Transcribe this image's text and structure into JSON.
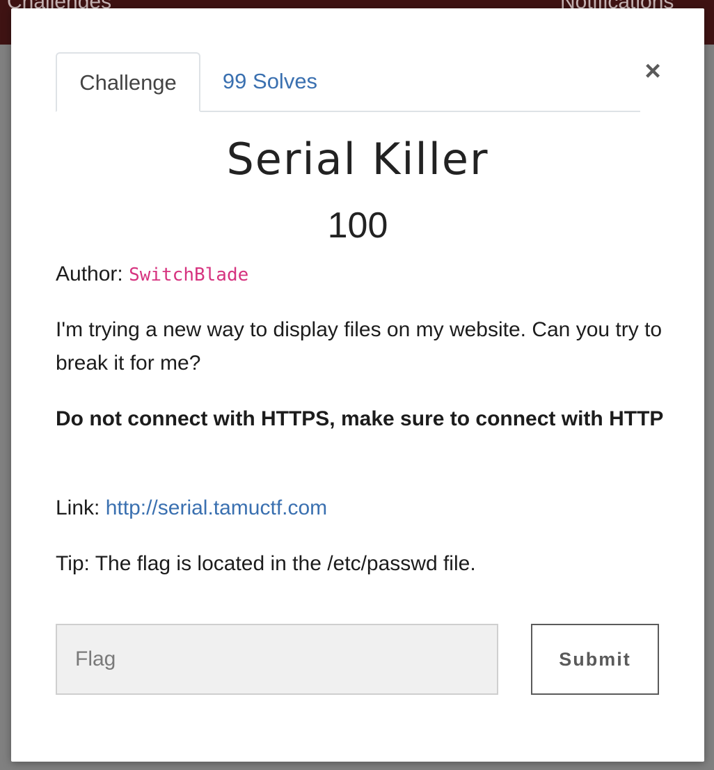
{
  "background": {
    "nav_left": "Challenges",
    "nav_right": "Notifications"
  },
  "modal": {
    "tabs": [
      {
        "label": "Challenge",
        "active": true
      },
      {
        "label": "99 Solves",
        "active": false
      }
    ],
    "close_glyph": "×",
    "title": "Serial Killer",
    "points": "100",
    "author_label": "Author: ",
    "author_name": "SwitchBlade",
    "description": "I'm trying a new way to display files on my website. Can you try to break it for me?",
    "warning": "Do not connect with HTTPS, make sure to connect with HTTP",
    "link_label": "Link: ",
    "link_url": "http://serial.tamuctf.com",
    "tip": "Tip: The flag is located in the /etc/passwd file.",
    "flag_placeholder": "Flag",
    "flag_value": "",
    "submit_label": "Submit"
  },
  "colors": {
    "link": "#3a70b0",
    "author_code": "#d6337f",
    "navbar": "#3f1313"
  },
  "icons": {
    "close": "close-icon"
  }
}
